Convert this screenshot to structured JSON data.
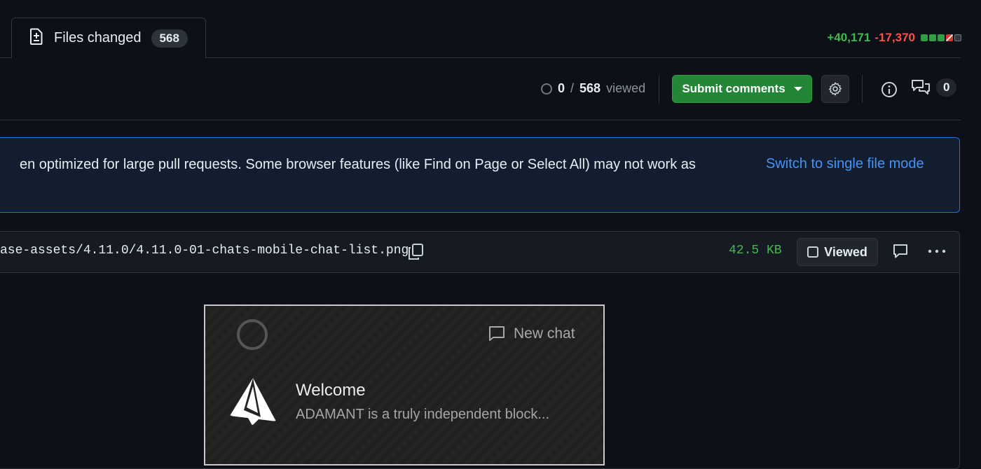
{
  "tabs": {
    "files_changed": {
      "label": "Files changed",
      "count": "568",
      "icon": "file-diff-icon"
    }
  },
  "diffstat": {
    "additions": "+40,171",
    "deletions": "-17,370"
  },
  "toolbar": {
    "viewed_count": "0",
    "viewed_sep": "/",
    "viewed_total": "568",
    "viewed_word": "viewed",
    "submit_label": "Submit comments",
    "comments_count": "0"
  },
  "banner": {
    "text": "en optimized for large pull requests. Some browser features (like Find on Page or Select All) may not work as",
    "link": "Switch to single file mode"
  },
  "file": {
    "path": "ase-assets/4.11.0/4.11.0-01-chats-mobile-chat-list.png",
    "size": "42.5 KB",
    "viewed_label": "Viewed"
  },
  "preview": {
    "new_chat": "New chat",
    "chat_title": "Welcome",
    "chat_preview": "ADAMANT is a truly independent block..."
  },
  "colors": {
    "background": "#0d1117",
    "additions": "#3fb950",
    "deletions": "#f85149",
    "primary_button": "#238636",
    "link": "#4493f8",
    "banner_border": "#1f6feb"
  }
}
